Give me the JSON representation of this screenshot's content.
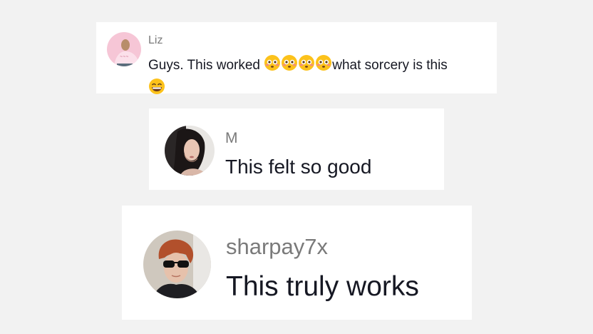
{
  "comments": [
    {
      "username": "Liz",
      "text": "Guys. This worked ",
      "text_after_emoji": "what sorcery is this",
      "emojis": [
        "flushed-face",
        "flushed-face",
        "flushed-face",
        "flushed-face"
      ],
      "trailing_emoji": "grinning-face",
      "avatar": "pink-avatar"
    },
    {
      "username": "M",
      "text": "This felt so good",
      "avatar": "woman-selfie-avatar"
    },
    {
      "username": "sharpay7x",
      "text": "This truly works",
      "avatar": "woman-sunglasses-avatar"
    }
  ],
  "colors": {
    "background": "#f2f2f2",
    "card": "#ffffff",
    "username": "#7a7a7a",
    "message": "#161823"
  }
}
